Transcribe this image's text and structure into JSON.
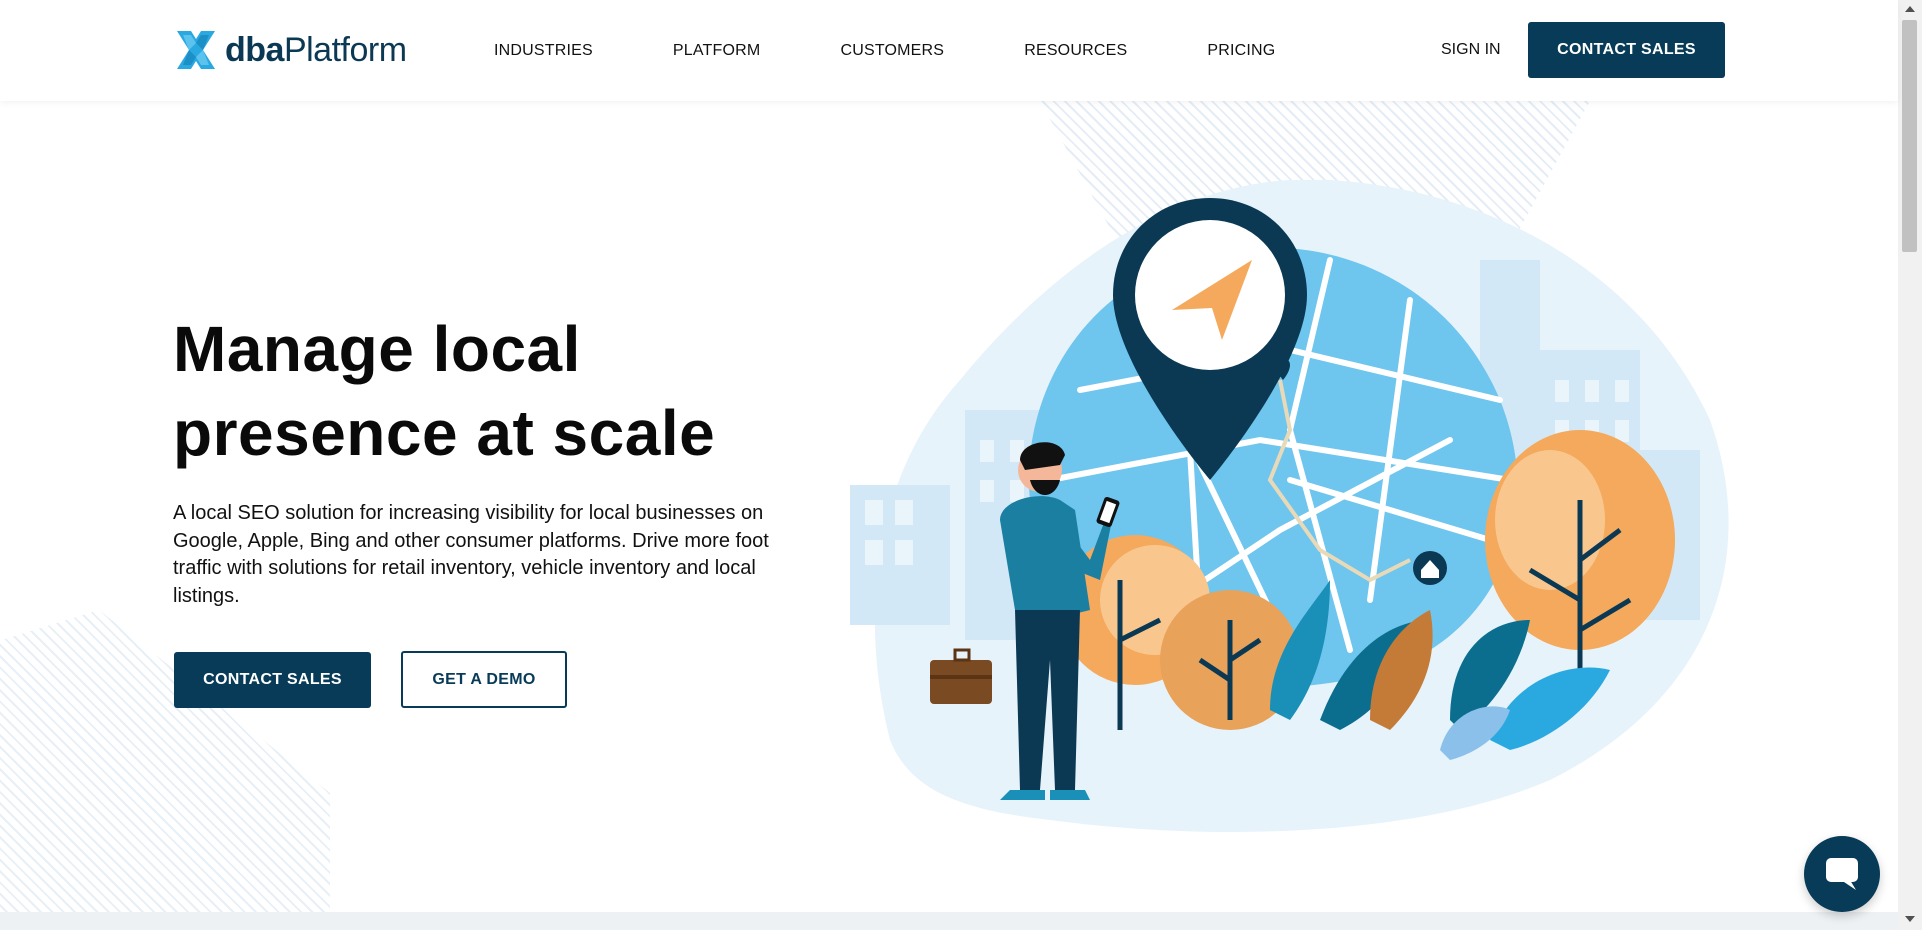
{
  "brand": {
    "name_bold": "dba",
    "name_thin": "Platform"
  },
  "nav": {
    "items": [
      "INDUSTRIES",
      "PLATFORM",
      "CUSTOMERS",
      "RESOURCES",
      "PRICING"
    ],
    "sign_in": "SIGN IN",
    "contact_sales": "CONTACT SALES"
  },
  "hero": {
    "title_line1": "Manage local",
    "title_line2": "presence at scale",
    "description": "A local SEO solution for increasing visibility for local businesses on Google, Apple, Bing and other consumer platforms. Drive more foot traffic with solutions for retail inventory, vehicle inventory and local listings.",
    "primary_cta": "CONTACT SALES",
    "secondary_cta": "GET A DEMO"
  },
  "colors": {
    "brand_navy": "#073b57",
    "logo_blue": "#2aa8e0",
    "illustration_orange": "#f4a95c",
    "illustration_light_blue": "#cfe9f8"
  },
  "icons": {
    "chat": "chat-bubble-icon",
    "logo": "dba-cross-logo-icon"
  }
}
